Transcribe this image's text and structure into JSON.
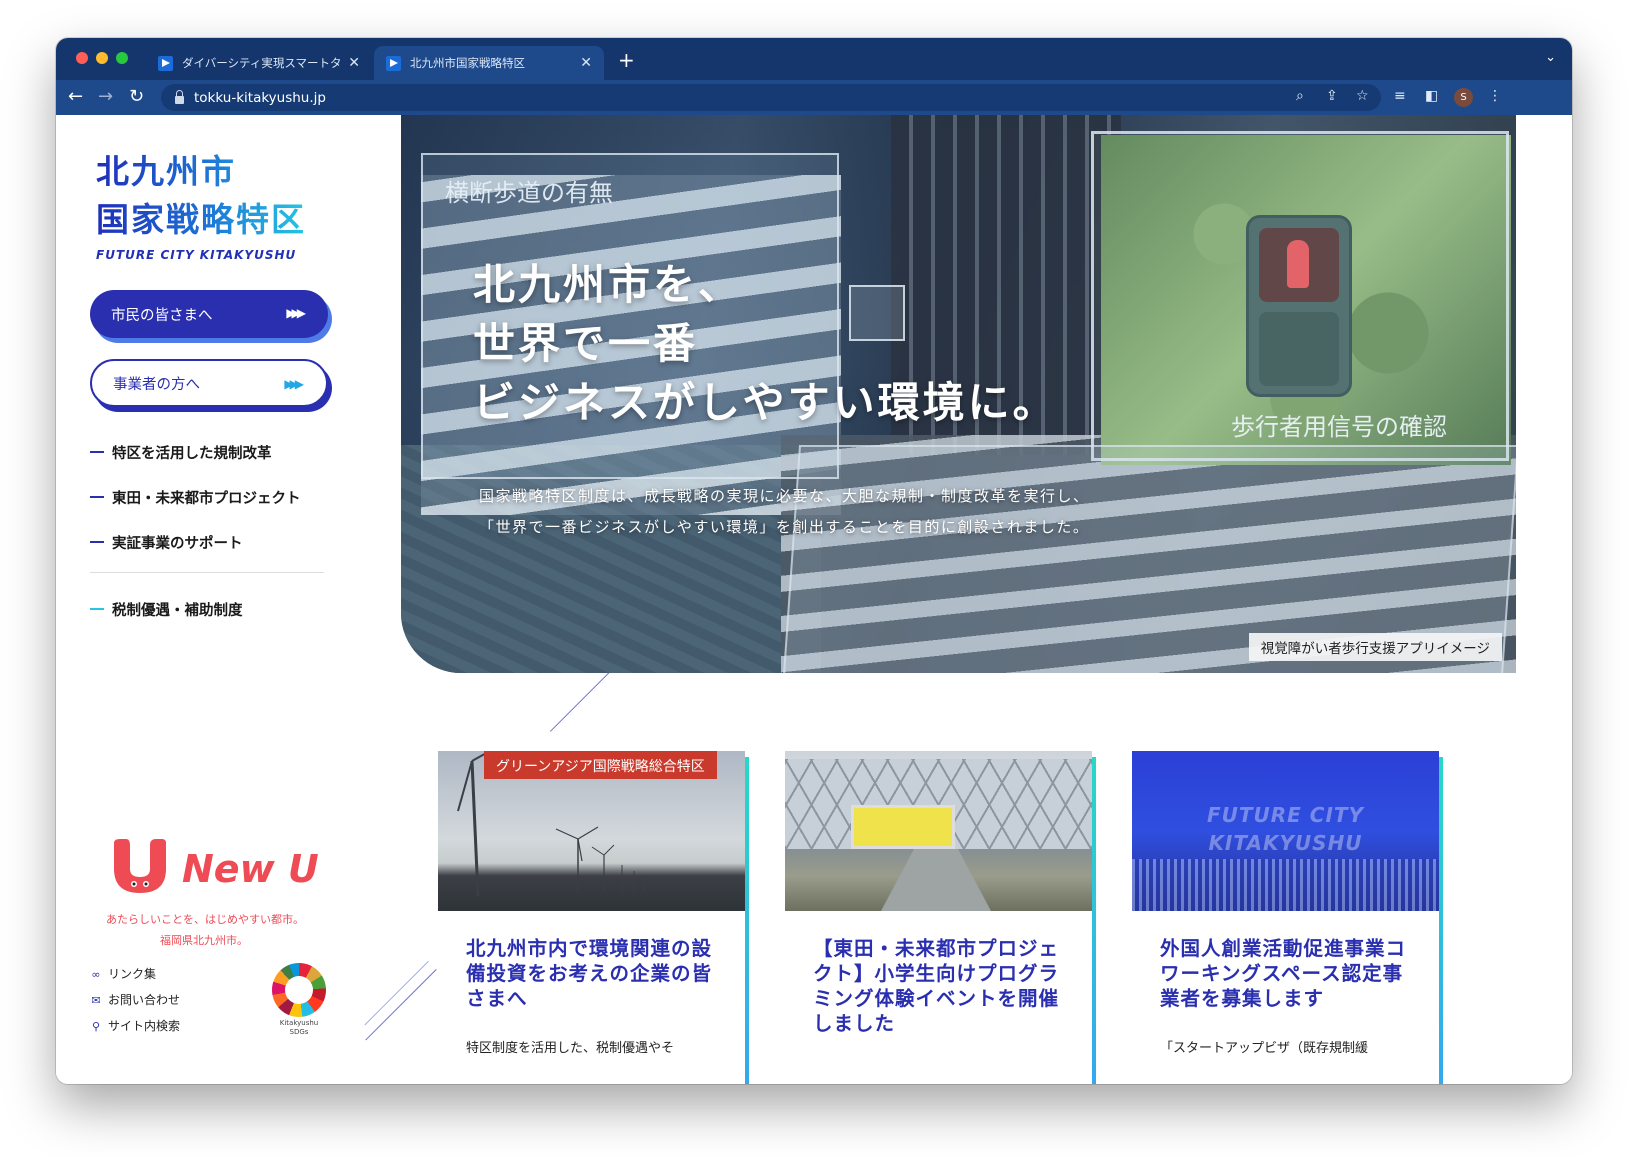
{
  "browser": {
    "tabs": [
      {
        "title": "ダイバーシティ実現スマートタウン"
      },
      {
        "title": "北九州市国家戦略特区"
      }
    ],
    "new_tab": "+",
    "tab_menu": "⌄",
    "url": "tokku-kitakyushu.jp",
    "avatar_letter": "S"
  },
  "logo": {
    "line1": "北九州市",
    "line2": "国家戦略特区",
    "line3": "FUTURE CITY KITAKYUSHU"
  },
  "buttons": {
    "citizen": "市民の皆さまへ",
    "business_highlight": "事業者",
    "business_rest": "の方へ",
    "arrows": "▶▶▶"
  },
  "sidenav": {
    "items": [
      {
        "label": "特区を活用した規制改革"
      },
      {
        "label": "東田・未来都市プロジェクト"
      },
      {
        "label": "実証事業のサポート"
      },
      {
        "label": "税制優遇・補助制度"
      }
    ]
  },
  "newu": {
    "word": "New U",
    "tagline1": "あたらしいことを、はじめやすい都市。",
    "tagline2": "福岡県北九州市。"
  },
  "footer_links": [
    {
      "label": "リンク集"
    },
    {
      "label": "お問い合わせ"
    },
    {
      "label": "サイト内検索"
    }
  ],
  "sdgs_label": "Kitakyushu SDGs",
  "hero": {
    "headline": [
      "北九州市を、",
      "世界で一番",
      "ビジネスがしやすい環境に。"
    ],
    "description": [
      "国家戦略特区制度は、成長戦略の実現に必要な、大胆な規制・制度改革を実行し、",
      "「世界で一番ビジネスがしやすい環境」を創出することを目的に創設されました。"
    ],
    "label_left": "横断歩道の有無",
    "label_right": "歩行者用信号の確認",
    "caption": "視覚障がい者歩行支援アプリイメージ"
  },
  "cards": [
    {
      "badge": "グリーンアジア国際戦略総合特区",
      "title": "北九州市内で環境関連の設備投資をお考えの企業の皆さまへ",
      "excerpt": "特区制度を活用した、税制優遇やそ"
    },
    {
      "title": "【東田・未来都市プロジェクト】小学生向けプログラミング体験イベントを開催しました",
      "excerpt": ""
    },
    {
      "image_text": [
        "FUTURE CITY",
        "KITAKYUSHU"
      ],
      "title": "外国人創業活動促進事業コワーキングスペース認定事業者を募集します",
      "excerpt": "「スタートアップビザ（既存規制緩"
    }
  ],
  "colors": {
    "brand_blue": "#2a2fb0",
    "accent_cyan": "#25c6e3",
    "newu_red": "#ee4b55",
    "badge_red": "#c93a2c",
    "browser_chrome": "#14366c"
  }
}
